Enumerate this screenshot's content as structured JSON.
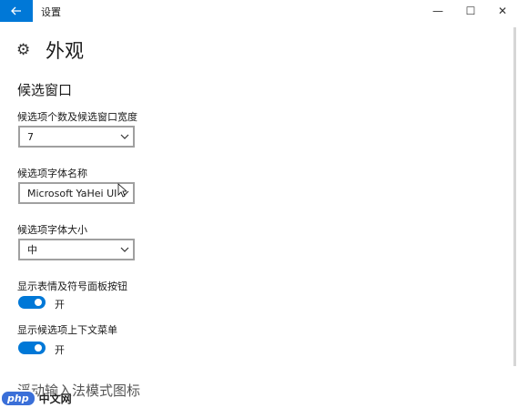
{
  "window": {
    "back_icon": "back-arrow-icon",
    "title": "设置",
    "minimize": "—",
    "maximize": "☐",
    "close": "✕"
  },
  "page": {
    "icon": "gear-icon",
    "title": "外观"
  },
  "candidate_section": {
    "title": "候选窗口",
    "count_label": "候选项个数及候选窗口宽度",
    "count_value": "7",
    "font_label": "候选项字体名称",
    "font_value": "Microsoft YaHei UI",
    "size_label": "候选项字体大小",
    "size_value": "中",
    "emoji_label": "显示表情及符号面板按钮",
    "emoji_toggle": "开",
    "emoji_on": true,
    "context_label": "显示候选项上下文菜单",
    "context_toggle": "开",
    "context_on": true
  },
  "floating_section": {
    "title": "浮动输入法模式图标"
  },
  "watermark": {
    "logo": "php",
    "text": "中文网"
  },
  "colors": {
    "accent": "#0078d7"
  }
}
